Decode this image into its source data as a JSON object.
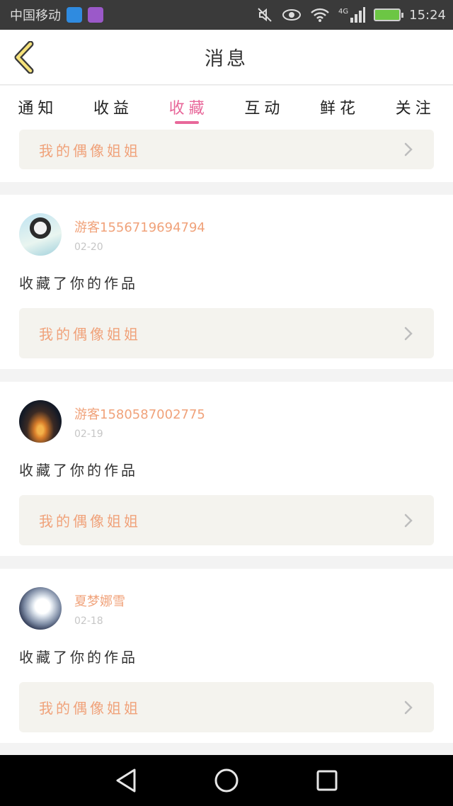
{
  "status_bar": {
    "carrier": "中国移动",
    "network": "4G",
    "time": "15:24",
    "icons": [
      "app-icon-blue",
      "app-icon-purple",
      "mute-icon",
      "eye-icon",
      "wifi-icon",
      "signal-icon",
      "battery-icon"
    ]
  },
  "header": {
    "title": "消息",
    "back_icon": "chevron-left-icon"
  },
  "tabs": [
    {
      "label": "通知"
    },
    {
      "label": "收益"
    },
    {
      "label": "收藏"
    },
    {
      "label": "互动"
    },
    {
      "label": "鲜花"
    },
    {
      "label": "关注"
    }
  ],
  "active_tab": "收藏",
  "top_card": {
    "work_title": "我的偶像姐姐"
  },
  "notifications": [
    {
      "user": "游客15567196947​94",
      "date": "02-20",
      "action": "收藏了你的作品",
      "work_title": "我的偶像姐姐"
    },
    {
      "user": "游客15805870027​75",
      "date": "02-19",
      "action": "收藏了你的作品",
      "work_title": "我的偶像姐姐"
    },
    {
      "user": "夏梦娜雪",
      "date": "02-18",
      "action": "收藏了你的作品",
      "work_title": "我的偶像姐姐"
    }
  ],
  "colors": {
    "accent": "#e8689a",
    "link_text": "#f0a27a",
    "link_bg": "#f4f3ee"
  }
}
